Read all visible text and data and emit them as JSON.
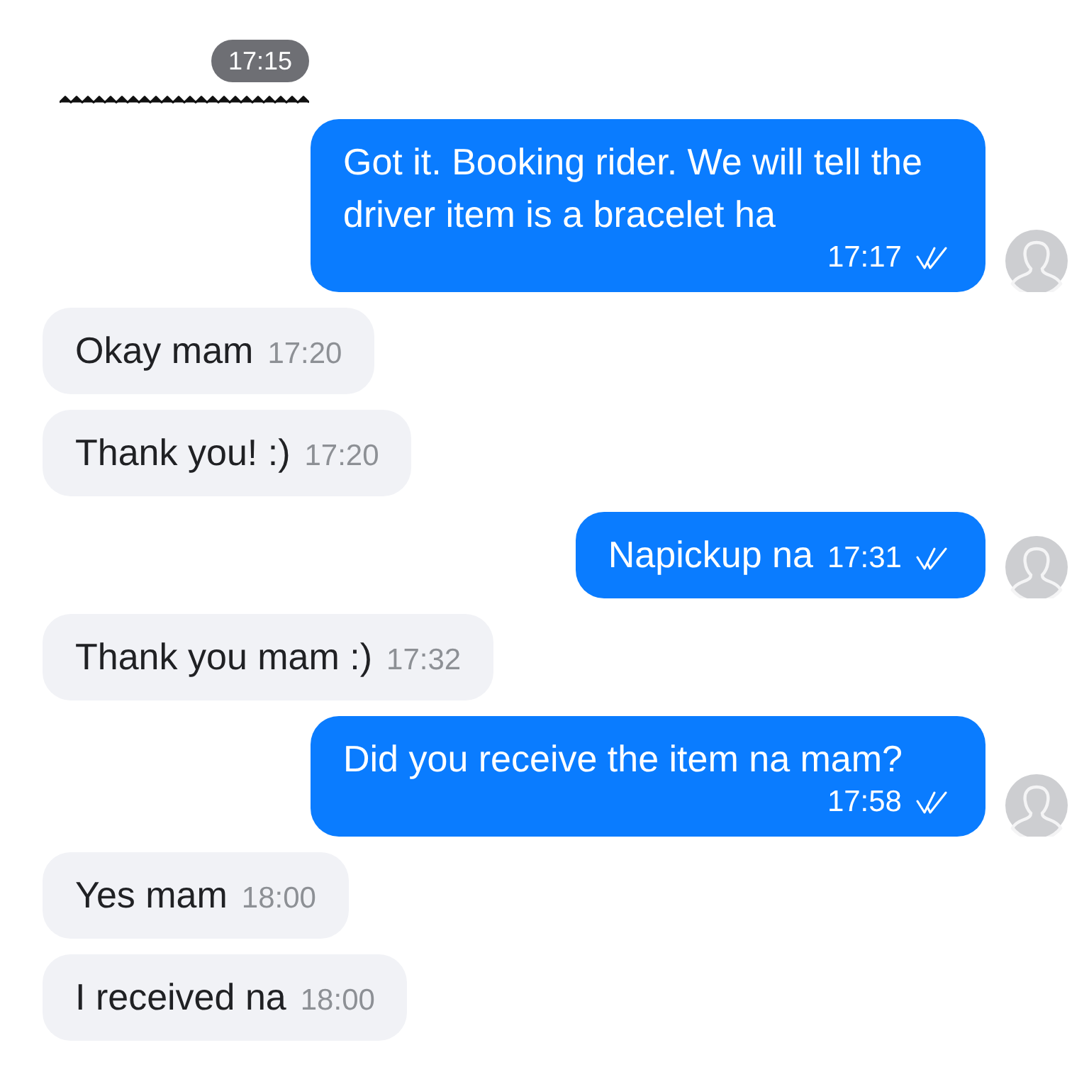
{
  "divider": {
    "time": "17:15"
  },
  "messages": [
    {
      "kind": "outgoing",
      "text": "Got it. Booking rider. We will tell the driver item is a bracelet ha",
      "time": "17:17",
      "read": true
    },
    {
      "kind": "incoming",
      "text": "Okay mam",
      "time": "17:20"
    },
    {
      "kind": "incoming",
      "text": "Thank you! :)",
      "time": "17:20"
    },
    {
      "kind": "outgoing",
      "text": "Napickup na",
      "time": "17:31",
      "read": true
    },
    {
      "kind": "incoming",
      "text": "Thank you mam :)",
      "time": "17:32"
    },
    {
      "kind": "outgoing",
      "text": "Did you receive the item na mam?",
      "time": "17:58",
      "read": true
    },
    {
      "kind": "incoming",
      "text": "Yes mam",
      "time": "18:00"
    },
    {
      "kind": "incoming",
      "text": "I received na",
      "time": "18:00"
    }
  ]
}
